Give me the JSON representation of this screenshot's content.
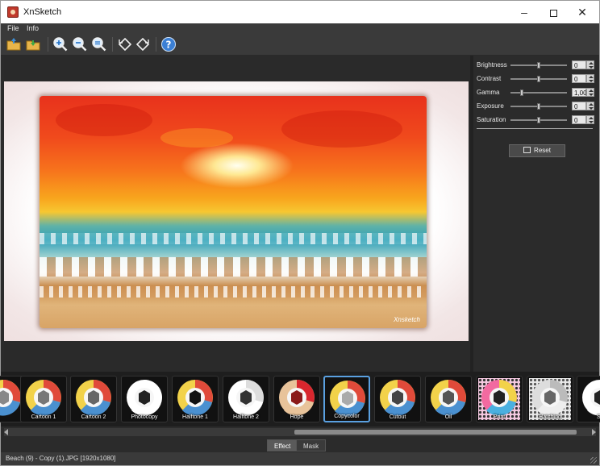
{
  "window": {
    "title": "XnSketch",
    "controls": [
      "–",
      "☐",
      "✕"
    ]
  },
  "menu": {
    "items": [
      {
        "label": "File"
      },
      {
        "label": "Info"
      }
    ]
  },
  "toolbar": {
    "buttons": [
      {
        "name": "open-folder",
        "icon": "folder-open-icon"
      },
      {
        "name": "save",
        "icon": "folder-save-icon"
      },
      {
        "name": "zoom-in",
        "icon": "zoom-in-icon"
      },
      {
        "name": "zoom-out",
        "icon": "zoom-out-icon"
      },
      {
        "name": "zoom-fit",
        "icon": "zoom-fit-icon"
      },
      {
        "name": "rotate-left",
        "icon": "rotate-left-icon"
      },
      {
        "name": "rotate-right",
        "icon": "rotate-right-icon"
      },
      {
        "name": "help",
        "icon": "help-icon"
      }
    ]
  },
  "adjustments": [
    {
      "label": "Brightness",
      "value": "0",
      "level": 0.5
    },
    {
      "label": "Contrast",
      "value": "0",
      "level": 0.5
    },
    {
      "label": "Gamma",
      "value": "1,00",
      "level": 0.2
    },
    {
      "label": "Exposure",
      "value": "0",
      "level": 0.5
    },
    {
      "label": "Saturation",
      "value": "0",
      "level": 0.5
    }
  ],
  "reset": {
    "label": "Reset"
  },
  "preview": {
    "signature": "Xnsketch"
  },
  "effects": [
    {
      "label": ""
    },
    {
      "label": "Cartoon 1"
    },
    {
      "label": "Cartoon 2"
    },
    {
      "label": "Photocopy"
    },
    {
      "label": "Halftone 1"
    },
    {
      "label": "Halftone 2"
    },
    {
      "label": "Hope"
    },
    {
      "label": "Copycolor",
      "selected": true
    },
    {
      "label": "Cutout"
    },
    {
      "label": "Oil"
    },
    {
      "label": "Print"
    },
    {
      "label": "Hatching"
    },
    {
      "label": "Sk"
    }
  ],
  "tabs": [
    {
      "label": "Effect",
      "active": true
    },
    {
      "label": "Mask",
      "active": false
    }
  ],
  "status": {
    "text": "Beach (9) - Copy (1).JPG [1920x1080]"
  }
}
